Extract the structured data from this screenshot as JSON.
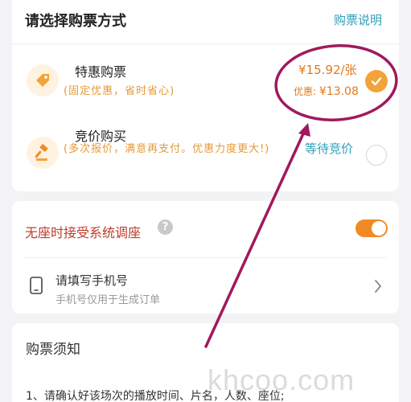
{
  "purchase_method": {
    "title": "请选择购票方式",
    "info_link": "购票说明",
    "options": [
      {
        "title": "特惠购票",
        "description": "(固定优惠，省时省心)",
        "price": "¥15.92/张",
        "discount_label": "优惠:",
        "discount_value": "¥13.08",
        "selected": true,
        "icon": "price-tag-icon"
      },
      {
        "title": "竞价购买",
        "description": "(多次报价，满意再支付。优惠力度更大!)",
        "status": "等待竞价",
        "selected": false,
        "icon": "auction-hammer-icon"
      }
    ]
  },
  "seat_adjust": {
    "label": "无座时接受系统调座",
    "help_glyph": "?",
    "enabled": true
  },
  "phone": {
    "title": "请填写手机号",
    "subtitle": "手机号仅用于生成订单",
    "icon": "phone-icon"
  },
  "notice": {
    "title": "购票须知",
    "first_line": "1、请确认好该场次的播放时间、片名，人数、座位;"
  },
  "watermark": "khcoo.com",
  "colors": {
    "accent_orange": "#f2a33a",
    "link_teal": "#2f9fb8",
    "annotation": "#a0195c"
  }
}
